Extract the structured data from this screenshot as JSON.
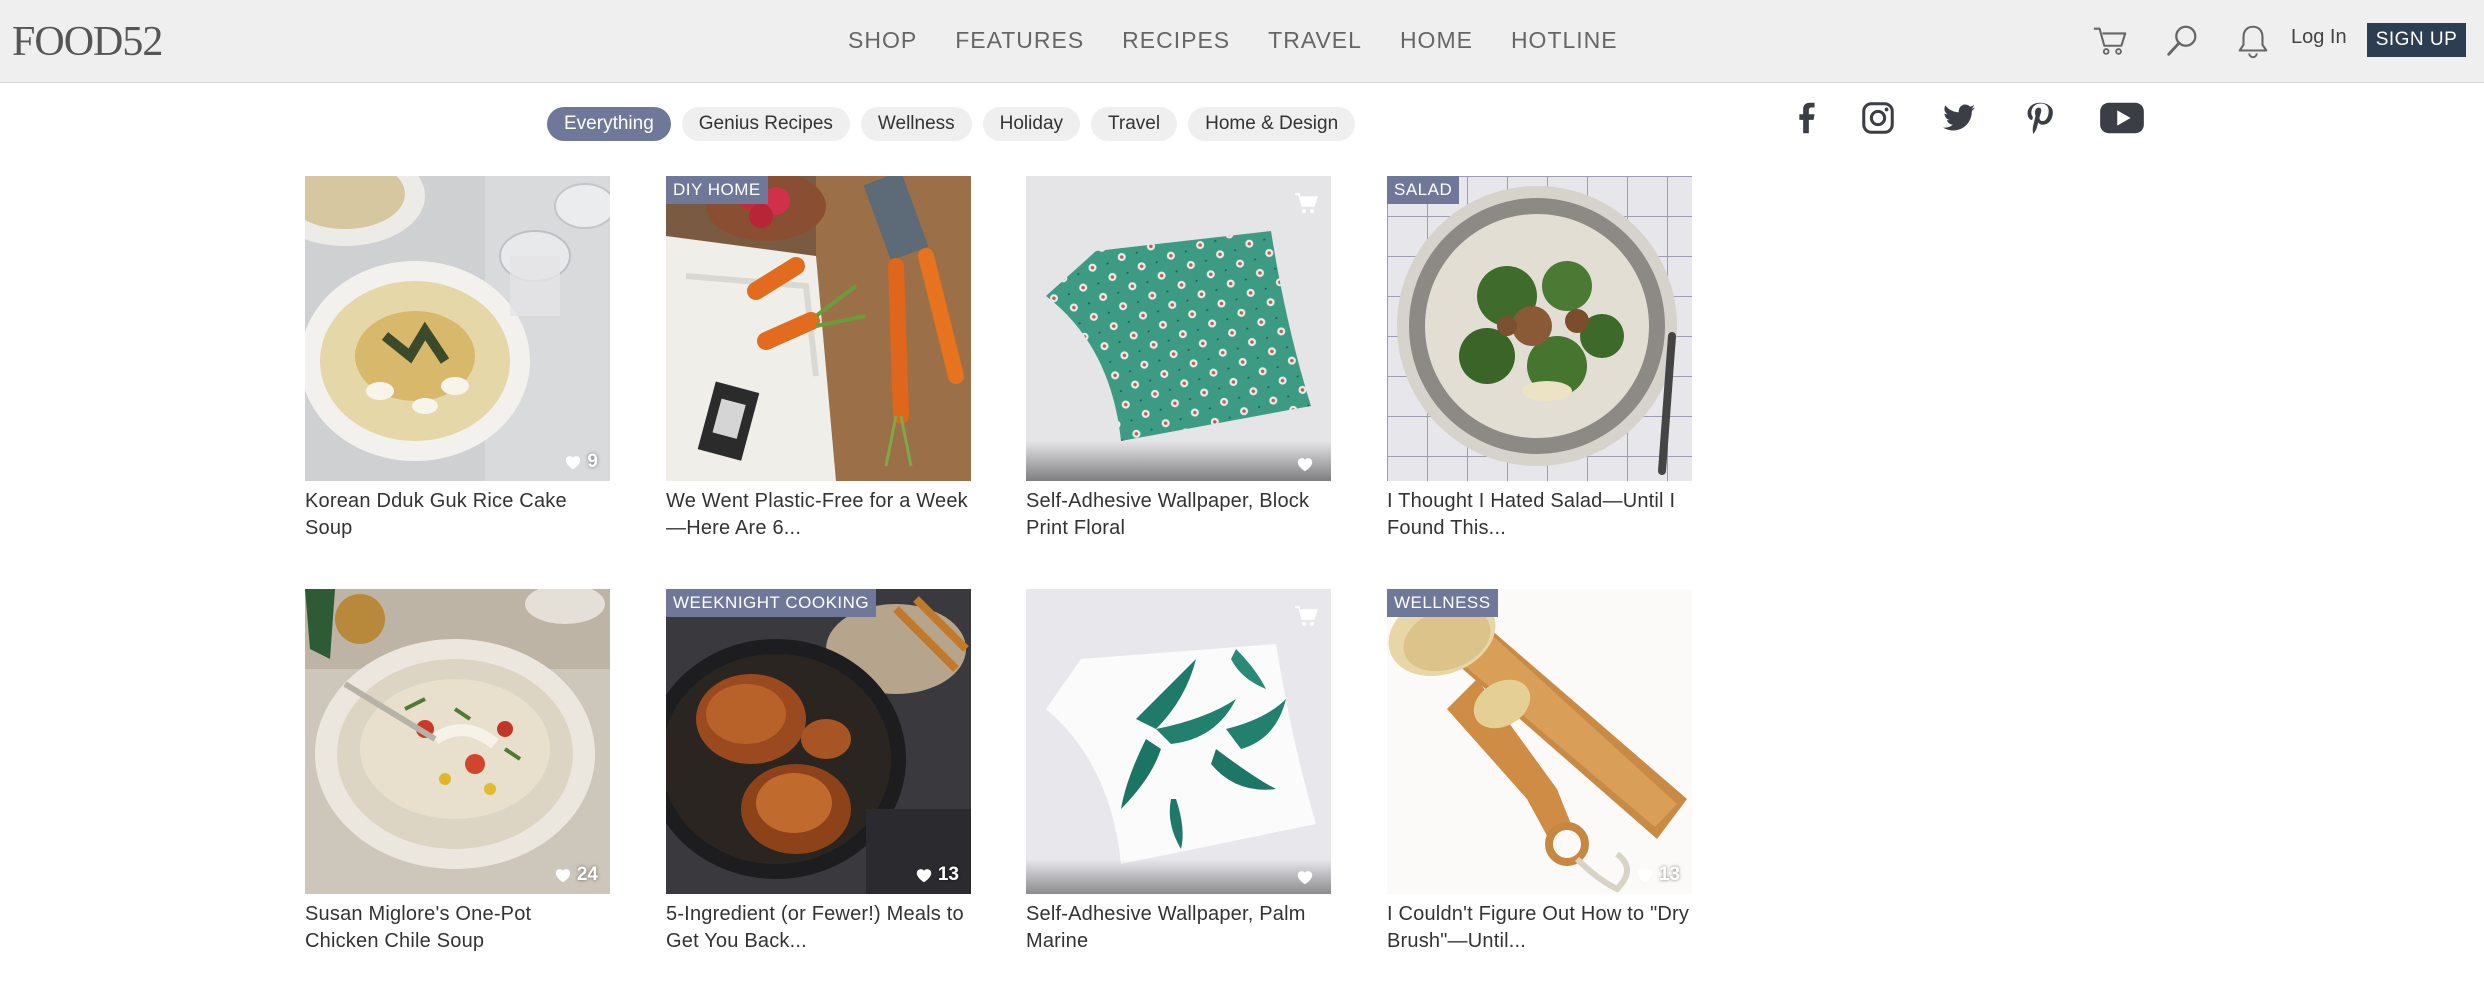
{
  "header": {
    "logo": "FOOD52",
    "nav": [
      "SHOP",
      "FEATURES",
      "RECIPES",
      "TRAVEL",
      "HOME",
      "HOTLINE"
    ],
    "login": "Log In",
    "signup": "SIGN UP",
    "icons": [
      "cart-icon",
      "search-icon",
      "bell-icon"
    ]
  },
  "filters": [
    "Everything",
    "Genius Recipes",
    "Wellness",
    "Holiday",
    "Travel",
    "Home & Design"
  ],
  "filters_active": "Everything",
  "social": [
    "facebook-icon",
    "instagram-icon",
    "twitter-icon",
    "pinterest-icon",
    "youtube-icon"
  ],
  "cards": [
    {
      "title": "Korean Dduk Guk Rice Cake Soup",
      "tag": "",
      "likes": "9"
    },
    {
      "title": "We Went Plastic-Free for a Week—Here Are 6...",
      "tag": "DIY HOME",
      "likes": ""
    },
    {
      "title": "Self-Adhesive Wallpaper, Block Print Floral",
      "tag": "",
      "likes": ""
    },
    {
      "title": "I Thought I Hated Salad—Until I Found This...",
      "tag": "SALAD",
      "likes": ""
    },
    {
      "title": "Susan Miglore's One-Pot Chicken Chile Soup",
      "tag": "",
      "likes": "24"
    },
    {
      "title": "5-Ingredient (or Fewer!) Meals to Get You Back...",
      "tag": "WEEKNIGHT COOKING",
      "likes": "13"
    },
    {
      "title": "Self-Adhesive Wallpaper, Palm Marine",
      "tag": "",
      "likes": ""
    },
    {
      "title": "I Couldn't Figure Out How to \"Dry Brush\"—Until...",
      "tag": "WELLNESS",
      "likes": "13"
    }
  ],
  "colors": {
    "header_bg": "#efefef",
    "accent": "#6f7898",
    "signup_bg": "#2e3e52"
  }
}
